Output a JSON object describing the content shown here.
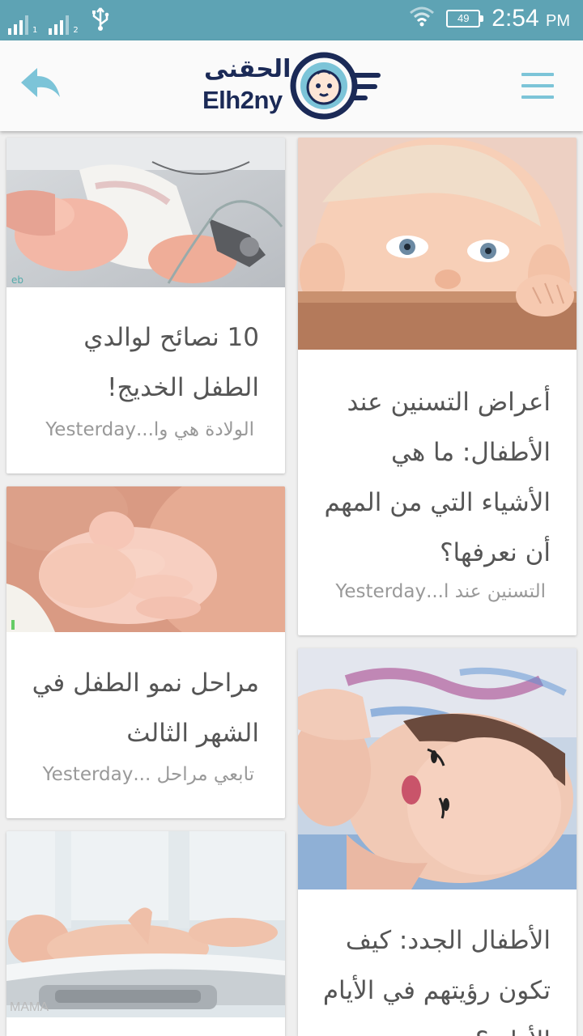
{
  "status_bar": {
    "sim1_label": "1",
    "sim2_label": "2",
    "battery_level": "49",
    "time": "2:54",
    "ampm": "PM"
  },
  "app_bar": {
    "logo_arabic": "الحقنى",
    "logo_english": "Elh2ny",
    "back_icon": "reply-arrow-icon",
    "menu_icon": "hamburger-menu-icon",
    "accent_color": "#7cc4d8",
    "brand_color": "#1b2a57"
  },
  "articles": [
    {
      "title": "10 نصائح لوالدي الطفل الخديج!",
      "excerpt": "الولادة هي وا...",
      "time": "Yesterday"
    },
    {
      "title": "أعراض التسنين عند الأطفال: ما هي الأشياء التي من المهم أن نعرفها؟",
      "excerpt": "التسنين عند ا...",
      "time": "Yesterday"
    },
    {
      "title": "مراحل نمو الطفل في الشهر الثالث",
      "excerpt": "تابعي مراحل ...",
      "time": "Yesterday"
    },
    {
      "title": "الأطفال الجدد: كيف تكون رؤيتهم في الأيام الأولى؟",
      "excerpt": "",
      "time": ""
    },
    {
      "title": "",
      "excerpt": "",
      "time": ""
    }
  ]
}
